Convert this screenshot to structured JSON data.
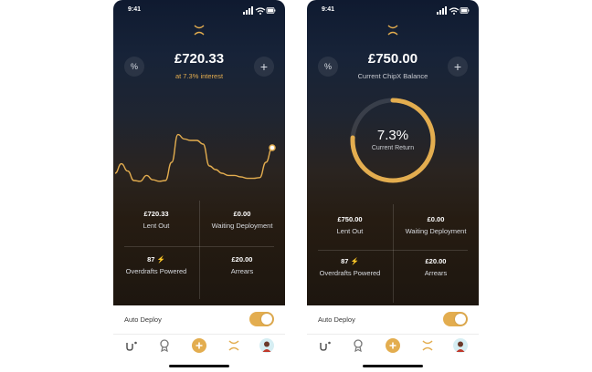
{
  "status": {
    "time": "9:41"
  },
  "colors": {
    "accent": "#e3ad4f",
    "bg_top": "#0f1a30",
    "bg_bottom": "#1d160f"
  },
  "left": {
    "balance": "£720.33",
    "rate": "at 7.3% interest",
    "chart_data": {
      "type": "line",
      "values": [
        0.15,
        0.28,
        0.18,
        0.05,
        0.04,
        0.12,
        0.06,
        0.04,
        0.05,
        0.3,
        0.68,
        0.62,
        0.6,
        0.6,
        0.55,
        0.25,
        0.2,
        0.15,
        0.12,
        0.12,
        0.1,
        0.08,
        0.08,
        0.09,
        0.3,
        0.5
      ]
    },
    "stats": [
      {
        "value": "£720.33",
        "label": "Lent Out"
      },
      {
        "value": "£0.00",
        "label": "Waiting Deployment"
      },
      {
        "value": "87",
        "label": "Overdrafts Powered",
        "bolt": "⚡"
      },
      {
        "value": "£20.00",
        "label": "Arrears"
      }
    ],
    "auto_deploy_label": "Auto Deploy",
    "auto_deploy_on": true
  },
  "right": {
    "balance": "£750.00",
    "subtitle": "Current ChipX Balance",
    "ring_value": "7.3%",
    "ring_label": "Current Return",
    "ring_fraction": 0.76,
    "stats": [
      {
        "value": "£750.00",
        "label": "Lent Out"
      },
      {
        "value": "£0.00",
        "label": "Waiting Deployment"
      },
      {
        "value": "87",
        "label": "Overdrafts Powered",
        "bolt": "⚡"
      },
      {
        "value": "£20.00",
        "label": "Arrears"
      }
    ],
    "auto_deploy_label": "Auto Deploy",
    "auto_deploy_on": true
  },
  "icons": {
    "percent": "%",
    "plus": "+",
    "tabs": [
      "activity-icon",
      "award-icon",
      "add-icon",
      "chipx-logo-icon",
      "profile-avatar-icon"
    ]
  }
}
